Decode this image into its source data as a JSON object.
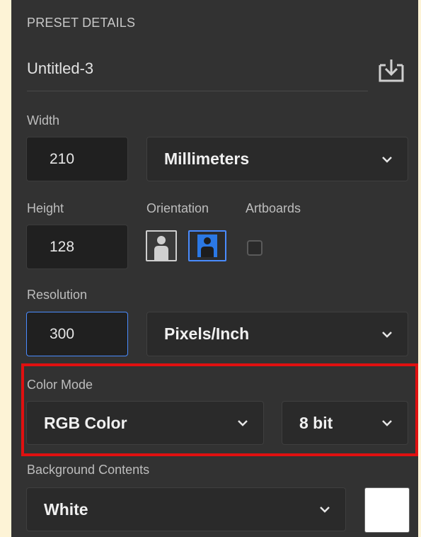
{
  "panel": {
    "title": "PRESET DETAILS",
    "document_name": "Untitled-3",
    "save_icon": "save-preset-icon"
  },
  "width": {
    "label": "Width",
    "value": "210",
    "unit": "Millimeters"
  },
  "height": {
    "label": "Height",
    "value": "128"
  },
  "orientation": {
    "label": "Orientation",
    "selected": "landscape"
  },
  "artboards": {
    "label": "Artboards",
    "checked": false
  },
  "resolution": {
    "label": "Resolution",
    "value": "300",
    "unit": "Pixels/Inch"
  },
  "color_mode": {
    "label": "Color Mode",
    "mode": "RGB Color",
    "bit_depth": "8 bit"
  },
  "background": {
    "label": "Background Contents",
    "value": "White",
    "swatch_color": "#ffffff"
  },
  "colors": {
    "panel_bg": "#323232",
    "page_bg": "#fdf3d6",
    "accent_blue": "#4a8cff",
    "highlight_red": "#e01010"
  }
}
